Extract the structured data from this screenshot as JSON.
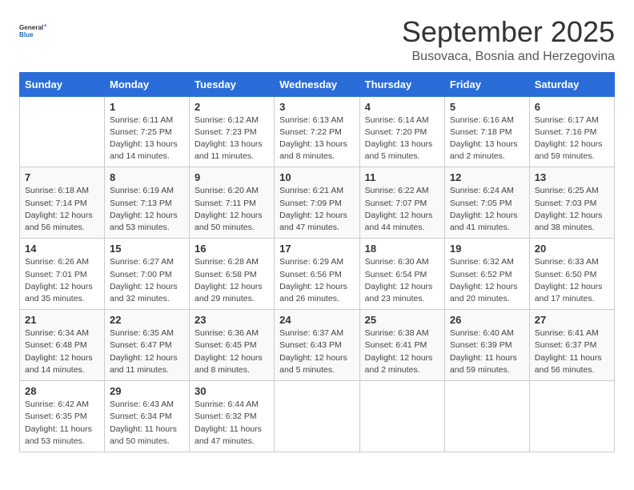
{
  "logo": {
    "line1": "General",
    "line2": "Blue"
  },
  "title": "September 2025",
  "subtitle": "Busovaca, Bosnia and Herzegovina",
  "days_of_week": [
    "Sunday",
    "Monday",
    "Tuesday",
    "Wednesday",
    "Thursday",
    "Friday",
    "Saturday"
  ],
  "weeks": [
    [
      {
        "day": "",
        "info": ""
      },
      {
        "day": "1",
        "info": "Sunrise: 6:11 AM\nSunset: 7:25 PM\nDaylight: 13 hours\nand 14 minutes."
      },
      {
        "day": "2",
        "info": "Sunrise: 6:12 AM\nSunset: 7:23 PM\nDaylight: 13 hours\nand 11 minutes."
      },
      {
        "day": "3",
        "info": "Sunrise: 6:13 AM\nSunset: 7:22 PM\nDaylight: 13 hours\nand 8 minutes."
      },
      {
        "day": "4",
        "info": "Sunrise: 6:14 AM\nSunset: 7:20 PM\nDaylight: 13 hours\nand 5 minutes."
      },
      {
        "day": "5",
        "info": "Sunrise: 6:16 AM\nSunset: 7:18 PM\nDaylight: 13 hours\nand 2 minutes."
      },
      {
        "day": "6",
        "info": "Sunrise: 6:17 AM\nSunset: 7:16 PM\nDaylight: 12 hours\nand 59 minutes."
      }
    ],
    [
      {
        "day": "7",
        "info": "Sunrise: 6:18 AM\nSunset: 7:14 PM\nDaylight: 12 hours\nand 56 minutes."
      },
      {
        "day": "8",
        "info": "Sunrise: 6:19 AM\nSunset: 7:13 PM\nDaylight: 12 hours\nand 53 minutes."
      },
      {
        "day": "9",
        "info": "Sunrise: 6:20 AM\nSunset: 7:11 PM\nDaylight: 12 hours\nand 50 minutes."
      },
      {
        "day": "10",
        "info": "Sunrise: 6:21 AM\nSunset: 7:09 PM\nDaylight: 12 hours\nand 47 minutes."
      },
      {
        "day": "11",
        "info": "Sunrise: 6:22 AM\nSunset: 7:07 PM\nDaylight: 12 hours\nand 44 minutes."
      },
      {
        "day": "12",
        "info": "Sunrise: 6:24 AM\nSunset: 7:05 PM\nDaylight: 12 hours\nand 41 minutes."
      },
      {
        "day": "13",
        "info": "Sunrise: 6:25 AM\nSunset: 7:03 PM\nDaylight: 12 hours\nand 38 minutes."
      }
    ],
    [
      {
        "day": "14",
        "info": "Sunrise: 6:26 AM\nSunset: 7:01 PM\nDaylight: 12 hours\nand 35 minutes."
      },
      {
        "day": "15",
        "info": "Sunrise: 6:27 AM\nSunset: 7:00 PM\nDaylight: 12 hours\nand 32 minutes."
      },
      {
        "day": "16",
        "info": "Sunrise: 6:28 AM\nSunset: 6:58 PM\nDaylight: 12 hours\nand 29 minutes."
      },
      {
        "day": "17",
        "info": "Sunrise: 6:29 AM\nSunset: 6:56 PM\nDaylight: 12 hours\nand 26 minutes."
      },
      {
        "day": "18",
        "info": "Sunrise: 6:30 AM\nSunset: 6:54 PM\nDaylight: 12 hours\nand 23 minutes."
      },
      {
        "day": "19",
        "info": "Sunrise: 6:32 AM\nSunset: 6:52 PM\nDaylight: 12 hours\nand 20 minutes."
      },
      {
        "day": "20",
        "info": "Sunrise: 6:33 AM\nSunset: 6:50 PM\nDaylight: 12 hours\nand 17 minutes."
      }
    ],
    [
      {
        "day": "21",
        "info": "Sunrise: 6:34 AM\nSunset: 6:48 PM\nDaylight: 12 hours\nand 14 minutes."
      },
      {
        "day": "22",
        "info": "Sunrise: 6:35 AM\nSunset: 6:47 PM\nDaylight: 12 hours\nand 11 minutes."
      },
      {
        "day": "23",
        "info": "Sunrise: 6:36 AM\nSunset: 6:45 PM\nDaylight: 12 hours\nand 8 minutes."
      },
      {
        "day": "24",
        "info": "Sunrise: 6:37 AM\nSunset: 6:43 PM\nDaylight: 12 hours\nand 5 minutes."
      },
      {
        "day": "25",
        "info": "Sunrise: 6:38 AM\nSunset: 6:41 PM\nDaylight: 12 hours\nand 2 minutes."
      },
      {
        "day": "26",
        "info": "Sunrise: 6:40 AM\nSunset: 6:39 PM\nDaylight: 11 hours\nand 59 minutes."
      },
      {
        "day": "27",
        "info": "Sunrise: 6:41 AM\nSunset: 6:37 PM\nDaylight: 11 hours\nand 56 minutes."
      }
    ],
    [
      {
        "day": "28",
        "info": "Sunrise: 6:42 AM\nSunset: 6:35 PM\nDaylight: 11 hours\nand 53 minutes."
      },
      {
        "day": "29",
        "info": "Sunrise: 6:43 AM\nSunset: 6:34 PM\nDaylight: 11 hours\nand 50 minutes."
      },
      {
        "day": "30",
        "info": "Sunrise: 6:44 AM\nSunset: 6:32 PM\nDaylight: 11 hours\nand 47 minutes."
      },
      {
        "day": "",
        "info": ""
      },
      {
        "day": "",
        "info": ""
      },
      {
        "day": "",
        "info": ""
      },
      {
        "day": "",
        "info": ""
      }
    ]
  ]
}
